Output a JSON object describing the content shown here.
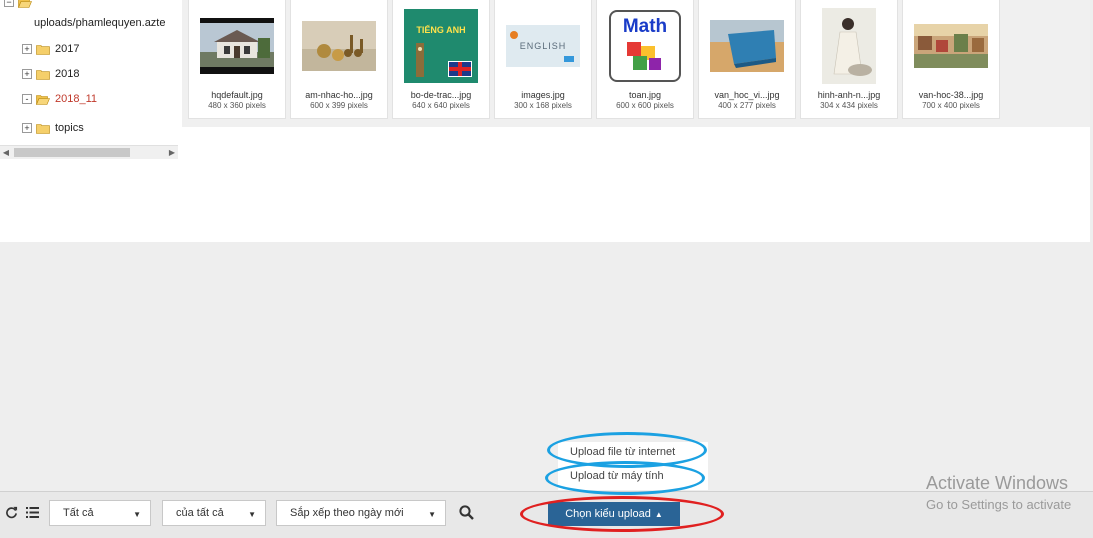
{
  "tree": {
    "root_path": "uploads/phamlequyen.azte",
    "folders": [
      {
        "label": "2017",
        "expand": "+",
        "active": false
      },
      {
        "label": "2018",
        "expand": "+",
        "active": false
      },
      {
        "label": "2018_11",
        "expand": "-",
        "active": true
      },
      {
        "label": "topics",
        "expand": "+",
        "active": false
      }
    ]
  },
  "files": [
    {
      "name": "hqdefault.jpg",
      "size": "480 x 360 pixels"
    },
    {
      "name": "am-nhac-ho...jpg",
      "size": "600 x 399 pixels"
    },
    {
      "name": "bo-de-trac...jpg",
      "size": "640 x 640 pixels"
    },
    {
      "name": "images.jpg",
      "size": "300 x 168 pixels"
    },
    {
      "name": "toan.jpg",
      "size": "600 x 600 pixels"
    },
    {
      "name": "van_hoc_vi...jpg",
      "size": "400 x 277 pixels"
    },
    {
      "name": "hinh-anh-n...jpg",
      "size": "304 x 434 pixels"
    },
    {
      "name": "van-hoc-38...jpg",
      "size": "700 x 400 pixels"
    }
  ],
  "thumbs": {
    "book_title": "TIẾNG ANH",
    "math_label": "Math",
    "english_label": "ENGLISH"
  },
  "toolbar": {
    "filter_type": "Tất cả",
    "filter_owner": "của tất cả",
    "sort": "Sắp xếp theo ngày mới",
    "upload_button": "Chọn kiểu upload"
  },
  "upload_menu": {
    "from_internet": "Upload file từ internet",
    "from_computer": "Upload từ máy tính"
  },
  "watermark": {
    "line1": "Activate Windows",
    "line2": "Go to Settings to activate"
  },
  "colors": {
    "upload_button": "#2a6496",
    "active_folder": "#c0392b",
    "ring_blue": "#1ba1e2",
    "ring_red": "#e02020"
  }
}
